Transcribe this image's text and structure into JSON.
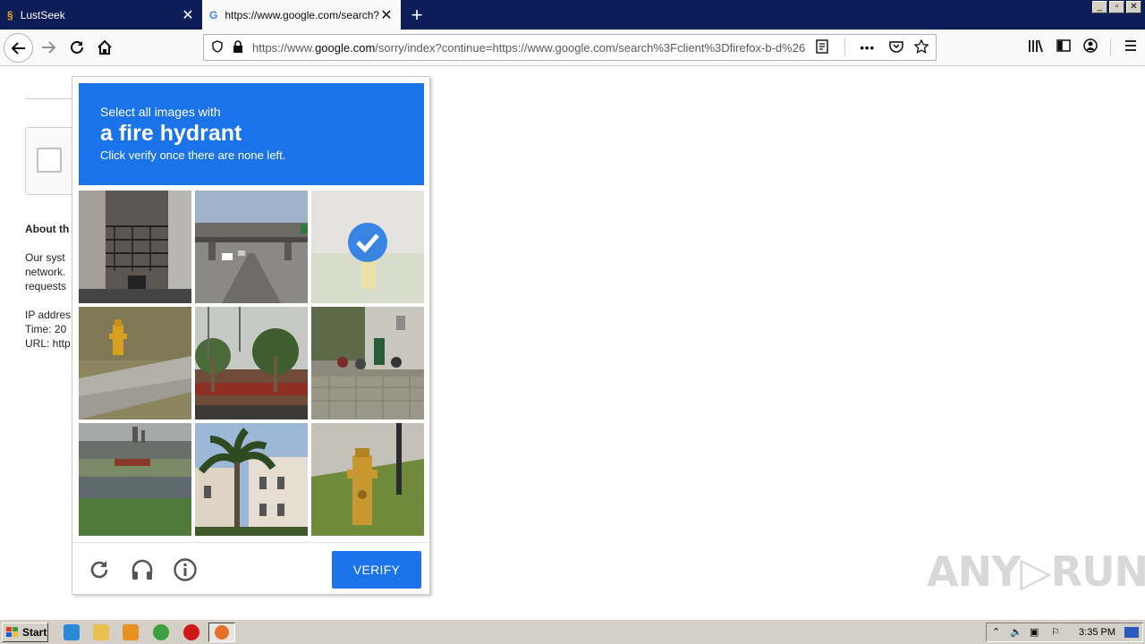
{
  "browser": {
    "tabs": [
      {
        "title": "LustSeek",
        "icon": "sword-favicon-icon"
      },
      {
        "title": "https://www.google.com/search?c",
        "icon": "google-favicon-icon"
      }
    ],
    "new_tab_symbol": "+",
    "url_prefix": "https://www.",
    "url_domain": "google.com",
    "url_rest": "/sorry/index?continue=https://www.google.com/search%3Fclient%3Dfirefox-b-d%26"
  },
  "page": {
    "about_heading": "About th",
    "para1": [
      "Our syst",
      "network.",
      "requests"
    ],
    "para2": [
      "IP addres",
      "Time: 20",
      "URL: http"
    ]
  },
  "captcha": {
    "instruction_line1": "Select all images with",
    "target": "a fire hydrant",
    "instruction_line3": "Click verify once there are none left.",
    "verify_label": "VERIFY",
    "selected_tiles": [
      2
    ]
  },
  "watermark": "ANY▷RUN",
  "taskbar": {
    "start_label": "Start",
    "clock": "3:35 PM"
  },
  "colors": {
    "accent": "#1a73e8",
    "tabbar": "#0c1d57"
  }
}
